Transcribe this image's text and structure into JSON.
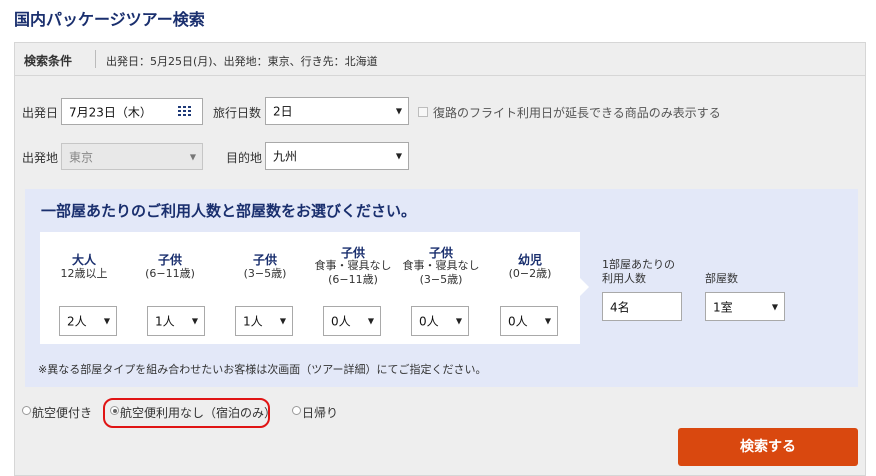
{
  "page": {
    "title": "国内パッケージツアー検索"
  },
  "criteria": {
    "label": "検索条件",
    "summary": "出発日：5月25日(月)、出発地：東京、行き先：北海道"
  },
  "form": {
    "departure_date": {
      "label": "出発日",
      "value": "7月23日（木）"
    },
    "trip_days": {
      "label": "旅行日数",
      "value": "2日"
    },
    "flight_option": {
      "label": "復路のフライト利用日が延長できる商品のみ表示する",
      "checked": false
    },
    "origin": {
      "label": "出発地",
      "value": "東京",
      "disabled": true
    },
    "destination": {
      "label": "目的地",
      "value": "九州"
    }
  },
  "pax": {
    "heading": "一部屋あたりのご利用人数と部屋数をお選びください。",
    "columns": [
      {
        "title": "大人",
        "sub1": "12歳以上",
        "sub2": "",
        "value": "2人"
      },
      {
        "title": "子供",
        "sub1": "(6−11歳)",
        "sub2": "",
        "value": "1人"
      },
      {
        "title": "子供",
        "sub1": "(3−5歳)",
        "sub2": "",
        "value": "1人"
      },
      {
        "title": "子供",
        "sub1": "食事・寝具なし",
        "sub2": "(6−11歳)",
        "value": "0人"
      },
      {
        "title": "子供",
        "sub1": "食事・寝具なし",
        "sub2": "(3−5歳)",
        "value": "0人"
      },
      {
        "title": "幼児",
        "sub1": "(0−2歳)",
        "sub2": "",
        "value": "0人"
      }
    ],
    "per_room_label_1": "1部屋あたりの",
    "per_room_label_2": "利用人数",
    "per_room_value": "4名",
    "rooms_label": "部屋数",
    "rooms_value": "1室",
    "note": "※異なる部屋タイプを組み合わせたいお客様は次画面（ツアー詳細）にてご指定ください。"
  },
  "trip_type": {
    "options": [
      "航空便付き",
      "航空便利用なし（宿泊のみ）",
      "日帰り"
    ],
    "selected_index": 1
  },
  "search_button": {
    "label": "検索する"
  },
  "colors": {
    "title": "#1a2f6e",
    "button": "#d9480f",
    "highlight": "#e01414",
    "pax_bg": "#e3e8f8"
  },
  "icons": {
    "date_picker": "calendar-icon",
    "select": "chevron-down-icon"
  }
}
